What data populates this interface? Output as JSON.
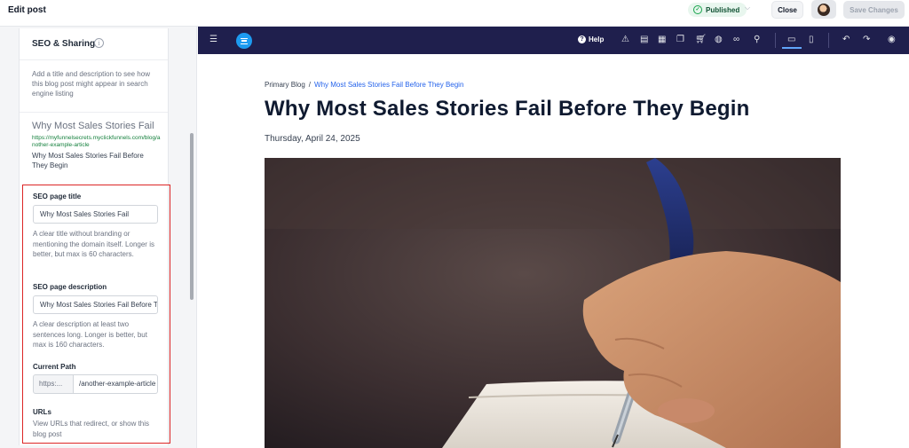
{
  "topbar": {
    "title": "Edit post",
    "status": "Published",
    "close_label": "Close",
    "save_label": "Save Changes"
  },
  "seo": {
    "section_title": "SEO & Sharing",
    "intro": "Add a title and description to see how this blog post might appear in search engine listing",
    "preview": {
      "title": "Why Most Sales Stories Fail",
      "url": "https://myfunnelsecrets.myclickfunnels.com/blog/another-example-article",
      "description": "Why Most Sales Stories Fail Before They Begin"
    },
    "page_title": {
      "label": "SEO page title",
      "value": "Why Most Sales Stories Fail",
      "help": "A clear title without branding or mentioning the domain itself. Longer is better, but max is 60 characters."
    },
    "page_description": {
      "label": "SEO page description",
      "value": "Why Most Sales Stories Fail Before They Begin",
      "help": "A clear description at least two sentences long. Longer is better, but max is 160 characters."
    },
    "current_path": {
      "label": "Current Path",
      "prefix": "https:...",
      "value": "/another-example-article"
    },
    "urls": {
      "label": "URLs",
      "help": "View URLs that redirect, or show this blog post"
    }
  },
  "editor_toolbar": {
    "help_label": "Help",
    "icons": [
      "menu-icon",
      "logo-icon",
      "help-icon",
      "warning-icon",
      "layout-icon",
      "qr-icon",
      "layers-icon",
      "cart-icon",
      "palette-icon",
      "link-icon",
      "search-icon",
      "desktop-icon",
      "mobile-icon",
      "undo-icon",
      "redo-icon",
      "preview-eye-icon"
    ]
  },
  "post": {
    "breadcrumb_root": "Primary Blog",
    "breadcrumb_sep": "/",
    "breadcrumb_current": "Why Most Sales Stories Fail Before They Begin",
    "title": "Why Most Sales Stories Fail Before They Begin",
    "date": "Thursday, April 24, 2025"
  },
  "colors": {
    "editor_bar": "#1f1f4d",
    "accent_blue": "#2563eb",
    "highlight_red": "#dc2626",
    "published_green": "#16a34a"
  }
}
